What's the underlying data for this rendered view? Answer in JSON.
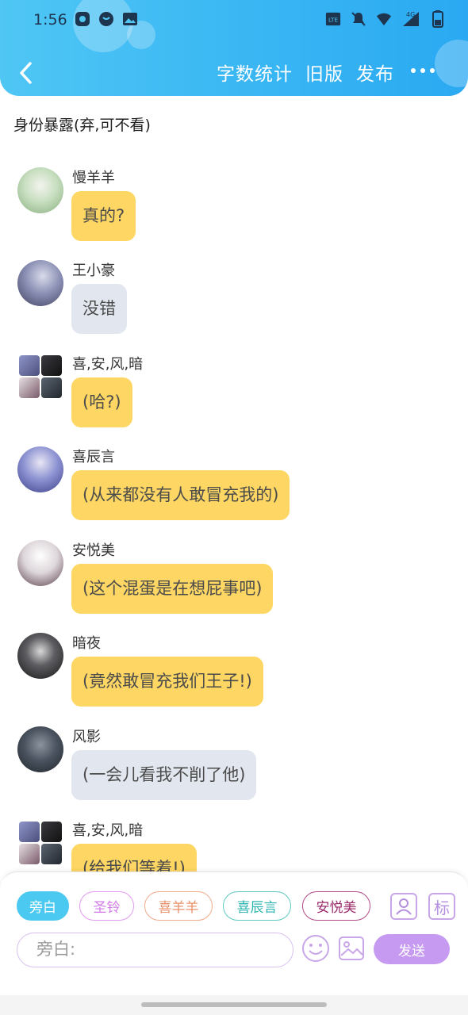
{
  "status_bar": {
    "time": "1:56",
    "network": "4G",
    "icons": [
      "game-icon",
      "moon-app-icon",
      "gallery-icon",
      "volte-icon",
      "mute-icon",
      "wifi-icon",
      "signal-icon",
      "battery-icon"
    ]
  },
  "nav": {
    "back_icon": "chevron-left-icon",
    "word_count": "字数统计",
    "old_version": "旧版",
    "publish": "发布",
    "more_icon": "more-dots-icon"
  },
  "story": {
    "title": "身份暴露(弃,可不看)"
  },
  "messages": [
    {
      "sender": "慢羊羊",
      "text": "真的?",
      "style": "yellow",
      "avatar_color": "#a7c7a0"
    },
    {
      "sender": "王小豪",
      "text": "没错",
      "style": "gray",
      "avatar_color": "#6a6f8c"
    },
    {
      "sender": "喜,安,风,暗",
      "text": "(哈?)",
      "style": "yellow",
      "avatar_color": "group"
    },
    {
      "sender": "喜辰言",
      "text": "(从来都没有人敢冒充我的)",
      "style": "yellow",
      "avatar_color": "#7c86c8"
    },
    {
      "sender": "安悦美",
      "text": "(这个混蛋是在想屁事吧)",
      "style": "yellow",
      "avatar_color": "#d9d2d6"
    },
    {
      "sender": "暗夜",
      "text": "(竟然敢冒充我们王子!)",
      "style": "yellow",
      "avatar_color": "#2a2a2e"
    },
    {
      "sender": "风影",
      "text": "(一会儿看我不削了他)",
      "style": "gray",
      "avatar_color": "#3b4452"
    },
    {
      "sender": "喜,安,风,暗",
      "text": "(给我们等着!)",
      "style": "yellow",
      "avatar_color": "group"
    }
  ],
  "panel": {
    "roles": [
      {
        "label": "旁白",
        "color": "#ffffff",
        "border": "#4cc9f0",
        "bg": "#4cc9f0"
      },
      {
        "label": "圣铃",
        "color": "#d27be8",
        "border": "#e29af0",
        "bg": "#ffffff"
      },
      {
        "label": "喜羊羊",
        "color": "#e8916a",
        "border": "#f0ab8a",
        "bg": "#ffffff"
      },
      {
        "label": "喜辰言",
        "color": "#2eb5b0",
        "border": "#5fcac5",
        "bg": "#ffffff"
      },
      {
        "label": "安悦美",
        "color": "#9b2a6a",
        "border": "#b14a86",
        "bg": "#ffffff"
      }
    ],
    "role_icon": "person-card-icon",
    "tag_icon_text": "标",
    "input_placeholder": "旁白:",
    "emoji_icon": "emoji-icon",
    "image_icon": "image-icon",
    "send_label": "发送"
  }
}
